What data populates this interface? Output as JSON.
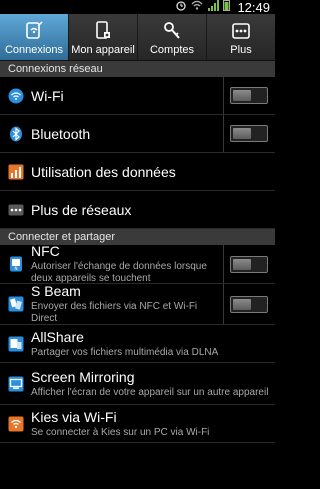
{
  "status": {
    "time": "12:49"
  },
  "tabs": [
    {
      "label": "Connexions",
      "icon": "connections-icon",
      "active": true
    },
    {
      "label": "Mon appareil",
      "icon": "device-icon",
      "active": false
    },
    {
      "label": "Comptes",
      "icon": "key-icon",
      "active": false
    },
    {
      "label": "Plus",
      "icon": "more-icon",
      "active": false
    }
  ],
  "sections": {
    "network": {
      "header": "Connexions réseau"
    },
    "share": {
      "header": "Connecter et partager"
    }
  },
  "items": {
    "wifi": {
      "title": "Wi-Fi",
      "toggle": "off"
    },
    "bluetooth": {
      "title": "Bluetooth",
      "toggle": "off"
    },
    "data": {
      "title": "Utilisation des données"
    },
    "more_networks": {
      "title": "Plus de réseaux"
    },
    "nfc": {
      "title": "NFC",
      "subtitle": "Autoriser l'échange de données lorsque deux appareils se touchent",
      "toggle": "off"
    },
    "sbeam": {
      "title": "S Beam",
      "subtitle": "Envoyer des fichiers via NFC et Wi-Fi Direct",
      "toggle": "off"
    },
    "allshare": {
      "title": "AllShare",
      "subtitle": "Partager vos fichiers multimédia via DLNA"
    },
    "mirroring": {
      "title": "Screen Mirroring",
      "subtitle": "Afficher l'écran de votre appareil sur un autre appareil"
    },
    "kies": {
      "title": "Kies via Wi-Fi",
      "subtitle": "Se connecter à Kies sur un PC via Wi-Fi"
    }
  },
  "colors": {
    "active_tab": "#3d86bc",
    "section_header": "#3a3a3a",
    "accent_blue": "#2b8fe0",
    "accent_orange": "#e8762a"
  }
}
